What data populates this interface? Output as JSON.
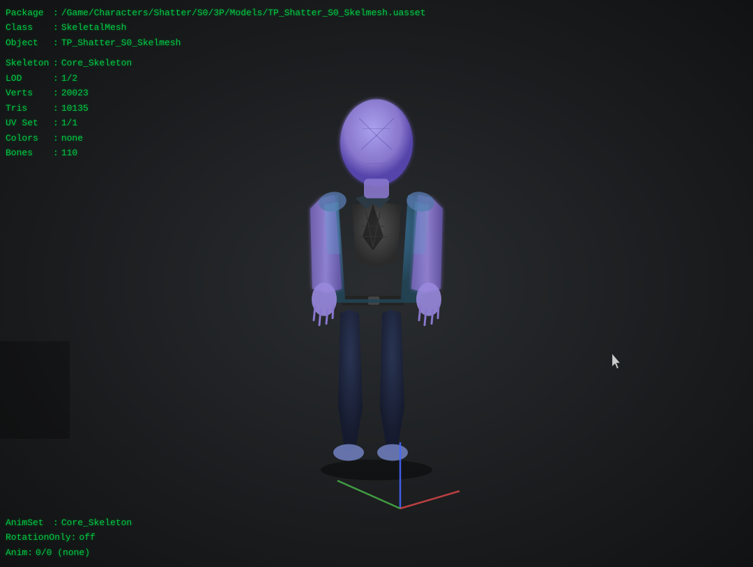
{
  "viewport": {
    "background_color": "#1a1a1a"
  },
  "info": {
    "package_label": "Package",
    "package_value": "/Game/Characters/Shatter/S0/3P/Models/TP_Shatter_S0_Skelmesh.uasset",
    "class_label": "Class",
    "class_value": "SkeletalMesh",
    "object_label": "Object",
    "object_value": "TP_Shatter_S0_Skelmesh",
    "skeleton_label": "Skeleton",
    "skeleton_value": "Core_Skeleton",
    "lod_label": "LOD",
    "lod_value": "1/2",
    "verts_label": "Verts",
    "verts_value": "20023",
    "tris_label": "Tris",
    "tris_value": "10135",
    "uvset_label": "UV Set",
    "uvset_value": "1/1",
    "colors_label": "Colors",
    "colors_value": "none",
    "bones_label": "Bones",
    "bones_value": "110"
  },
  "bottom_info": {
    "animset_label": "AnimSet",
    "animset_value": "Core_Skeleton",
    "rotation_label": "RotationOnly:",
    "rotation_value": "off",
    "anim_label": "Anim:",
    "anim_value": "0/0 (none)"
  }
}
